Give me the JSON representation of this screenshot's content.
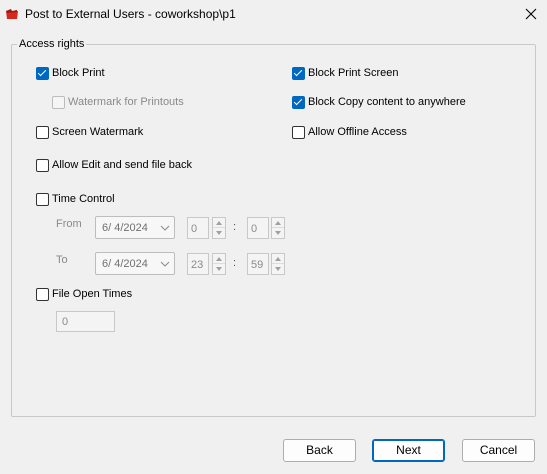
{
  "window": {
    "title": "Post to External Users - coworkshop\\p1",
    "app_icon": "red-folder-icon",
    "close_icon": "close-icon"
  },
  "access_rights": {
    "group_label": "Access rights",
    "block_print": {
      "label": "Block Print",
      "checked": true
    },
    "watermark_printouts": {
      "label": "Watermark for Printouts",
      "checked": false,
      "enabled": false
    },
    "screen_watermark": {
      "label": "Screen Watermark",
      "checked": false
    },
    "allow_edit": {
      "label": "Allow Edit and send file back",
      "checked": false
    },
    "time_control": {
      "label": "Time Control",
      "checked": false
    },
    "block_print_screen": {
      "label": "Block Print Screen",
      "checked": true
    },
    "block_copy": {
      "label": "Block Copy content to anywhere",
      "checked": true
    },
    "allow_offline": {
      "label": "Allow Offline Access",
      "checked": false
    },
    "file_open_times": {
      "label": "File Open Times",
      "checked": false,
      "value": "0"
    }
  },
  "time": {
    "from": {
      "label": "From",
      "date": "6/  4/2024",
      "hour": "0",
      "minute": "0"
    },
    "to": {
      "label": "To",
      "date": "6/  4/2024",
      "hour": "23",
      "minute": "59"
    },
    "separator": ":"
  },
  "buttons": {
    "back": "Back",
    "next": "Next",
    "cancel": "Cancel"
  },
  "colors": {
    "accent": "#0067c0",
    "window_bg": "#f0f0f0",
    "icon_red": "#d42a1e"
  }
}
